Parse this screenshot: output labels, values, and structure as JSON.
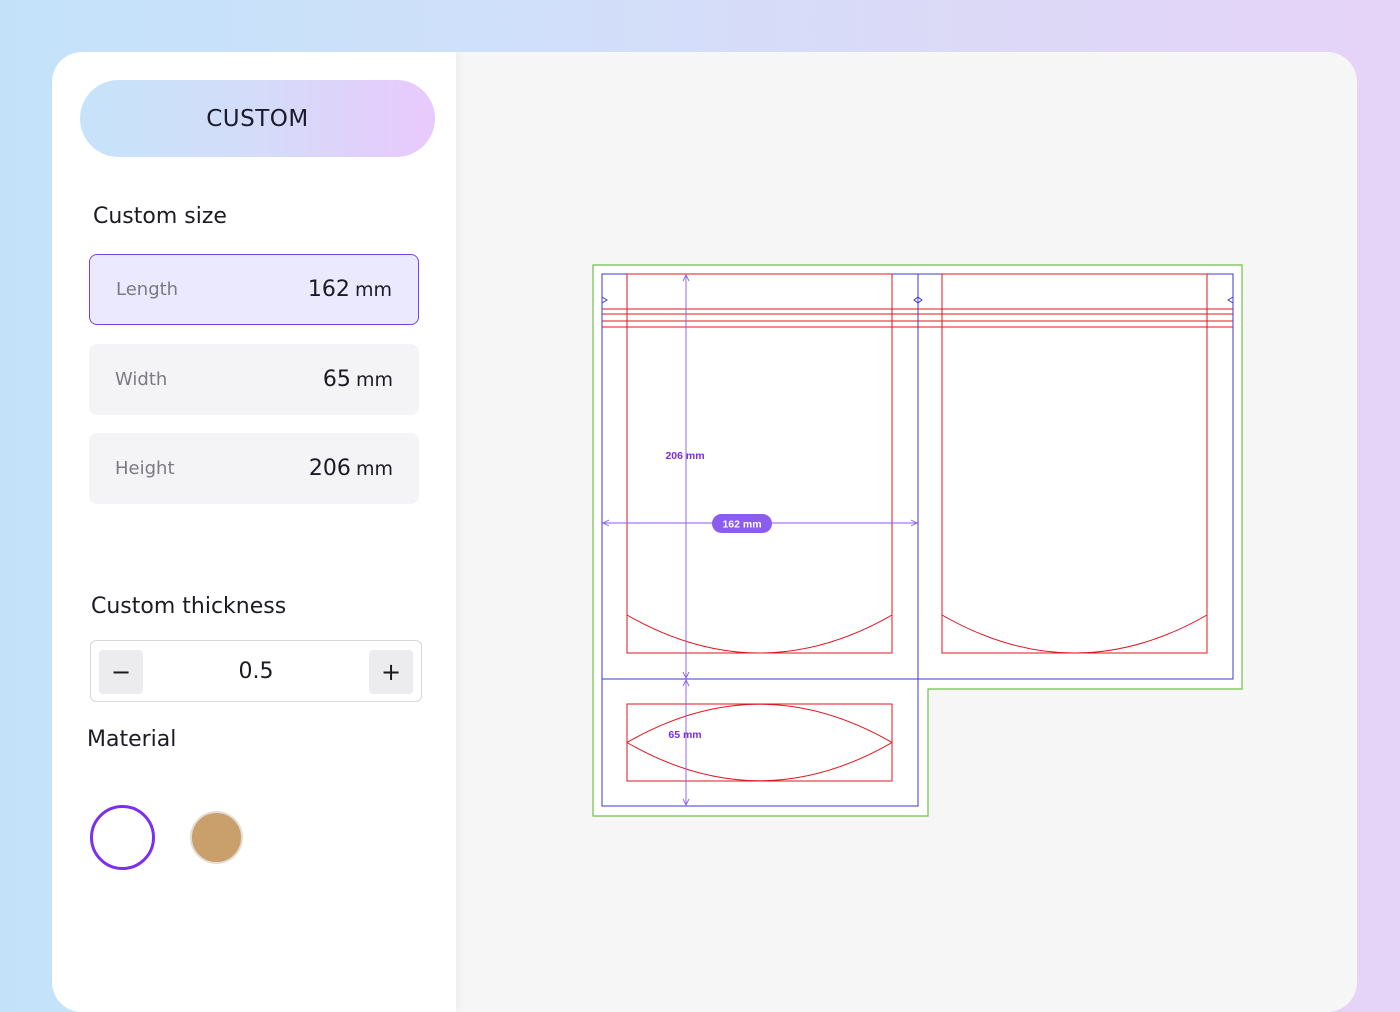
{
  "panel": {
    "mode_label": "CUSTOM",
    "size_section_title": "Custom size",
    "dimensions": [
      {
        "label": "Length",
        "value": "162",
        "unit": "mm",
        "active": true
      },
      {
        "label": "Width",
        "value": "65",
        "unit": "mm",
        "active": false
      },
      {
        "label": "Height",
        "value": "206",
        "unit": "mm",
        "active": false
      }
    ],
    "thickness_section_title": "Custom thickness",
    "thickness": {
      "value": "0.5",
      "decrement_label": "−",
      "increment_label": "+"
    },
    "material_section_title": "Material",
    "materials": [
      {
        "icon": "white-material-swatch",
        "color": "#ffffff",
        "selected": true
      },
      {
        "icon": "kraft-material-swatch",
        "color": "#c9a06c",
        "selected": false
      }
    ]
  },
  "dieline": {
    "height_label": "206 mm",
    "length_label": "162 mm",
    "width_label": "65 mm",
    "colors": {
      "bleed": "#6fc04a",
      "trim": "#3a3ad0",
      "cut": "#e0141e",
      "dimension": "#8c5ae8",
      "dimension_text": "#7a2ed8",
      "pill_bg": "#8b5cf0"
    }
  }
}
